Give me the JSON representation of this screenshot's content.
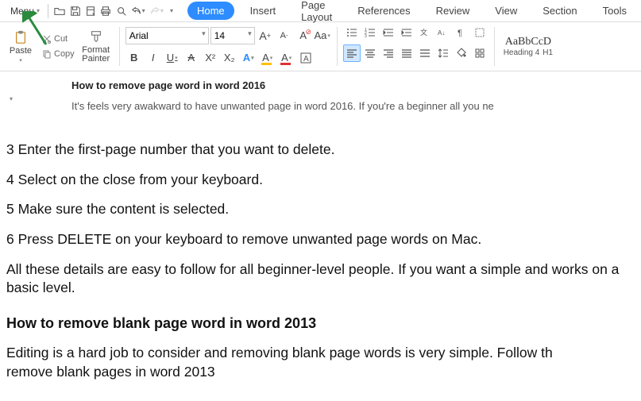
{
  "topbar": {
    "menu_label": "Menu"
  },
  "tabs": {
    "home": "Home",
    "insert": "Insert",
    "page_layout": "Page Layout",
    "references": "References",
    "review": "Review",
    "view": "View",
    "section": "Section",
    "tools": "Tools"
  },
  "ribbon": {
    "paste_label": "Paste",
    "cut_label": "Cut",
    "copy_label": "Copy",
    "format_painter_line1": "Format",
    "format_painter_line2": "Painter",
    "font_name": "Arial",
    "font_size": "14",
    "bold": "B",
    "italic": "I",
    "underline": "U",
    "strike": "A",
    "sup": "X²",
    "sub": "X₂",
    "char_a": "A",
    "style_preview": "AaBbCcD",
    "style_heading4": "Heading 4",
    "style_h1_short": "H1"
  },
  "doc_mini": {
    "title": "How to remove page word in word 2016",
    "body_clip": "It's feels very awakward to have unwanted page in word 2016. If you're a beginner all you ne"
  },
  "doc_main": {
    "p1": "3 Enter the first-page number that you want to delete.",
    "p2": "4 Select on the close from your keyboard.",
    "p3": "5 Make sure the content is selected.",
    "p4": "6 Press DELETE on your keyboard to remove unwanted page words on Mac.",
    "p5": "All these details are easy to follow for all beginner-level people. If you want a simple and works on a basic level.",
    "h2": "How to remove blank page word in word 2013",
    "p6_a": "Editing is a hard job to consider and removing blank page words is very simple. Follow th",
    "p6_b": "remove blank pages in word 2013"
  }
}
